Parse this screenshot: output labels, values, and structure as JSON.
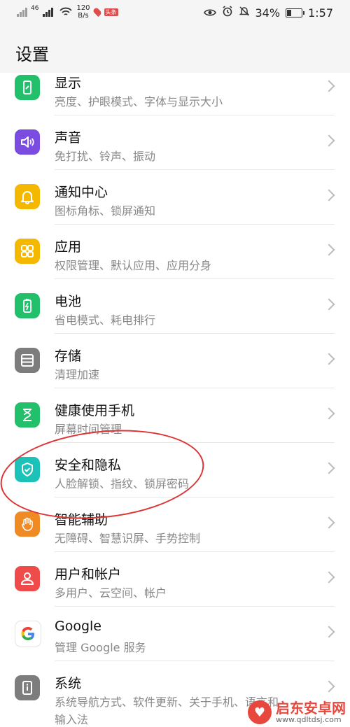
{
  "status_bar": {
    "net_label": "46",
    "speed_value": "120",
    "speed_unit": "B/s",
    "badge": "头条",
    "battery": "34%",
    "time": "1:57"
  },
  "header": {
    "title": "设置"
  },
  "items": [
    {
      "title": "显示",
      "sub": "亮度、护眼模式、字体与显示大小",
      "color": "#22c06a",
      "icon": "phone-display-icon"
    },
    {
      "title": "声音",
      "sub": "免打扰、铃声、振动",
      "color": "#7a4ce0",
      "icon": "speaker-icon"
    },
    {
      "title": "通知中心",
      "sub": "图标角标、锁屏通知",
      "color": "#f5b800",
      "icon": "bell-icon"
    },
    {
      "title": "应用",
      "sub": "权限管理、默认应用、应用分身",
      "color": "#f5b800",
      "icon": "apps-grid-icon"
    },
    {
      "title": "电池",
      "sub": "省电模式、耗电排行",
      "color": "#22c06a",
      "icon": "battery-icon"
    },
    {
      "title": "存储",
      "sub": "清理加速",
      "color": "#7d7d7d",
      "icon": "storage-icon"
    },
    {
      "title": "健康使用手机",
      "sub": "屏幕时间管理",
      "color": "#22c06a",
      "icon": "hourglass-icon"
    },
    {
      "title": "安全和隐私",
      "sub": "人脸解锁、指纹、锁屏密码",
      "color": "#1cc2b8",
      "icon": "shield-check-icon"
    },
    {
      "title": "智能辅助",
      "sub": "无障碍、智慧识屏、手势控制",
      "color": "#f08a24",
      "icon": "hand-icon"
    },
    {
      "title": "用户和帐户",
      "sub": "多用户、云空间、帐户",
      "color": "#ef4b4b",
      "icon": "user-icon"
    },
    {
      "title": "Google",
      "sub": "管理 Google 服务",
      "color": "#ffffff",
      "icon": "google-icon"
    },
    {
      "title": "系统",
      "sub": "系统导航方式、软件更新、关于手机、语言和",
      "sub2": "输入法",
      "color": "#7d7d7d",
      "icon": "system-info-icon"
    }
  ],
  "watermark": {
    "name": "启东安卓网",
    "url": "www.qdltdsj.com"
  }
}
